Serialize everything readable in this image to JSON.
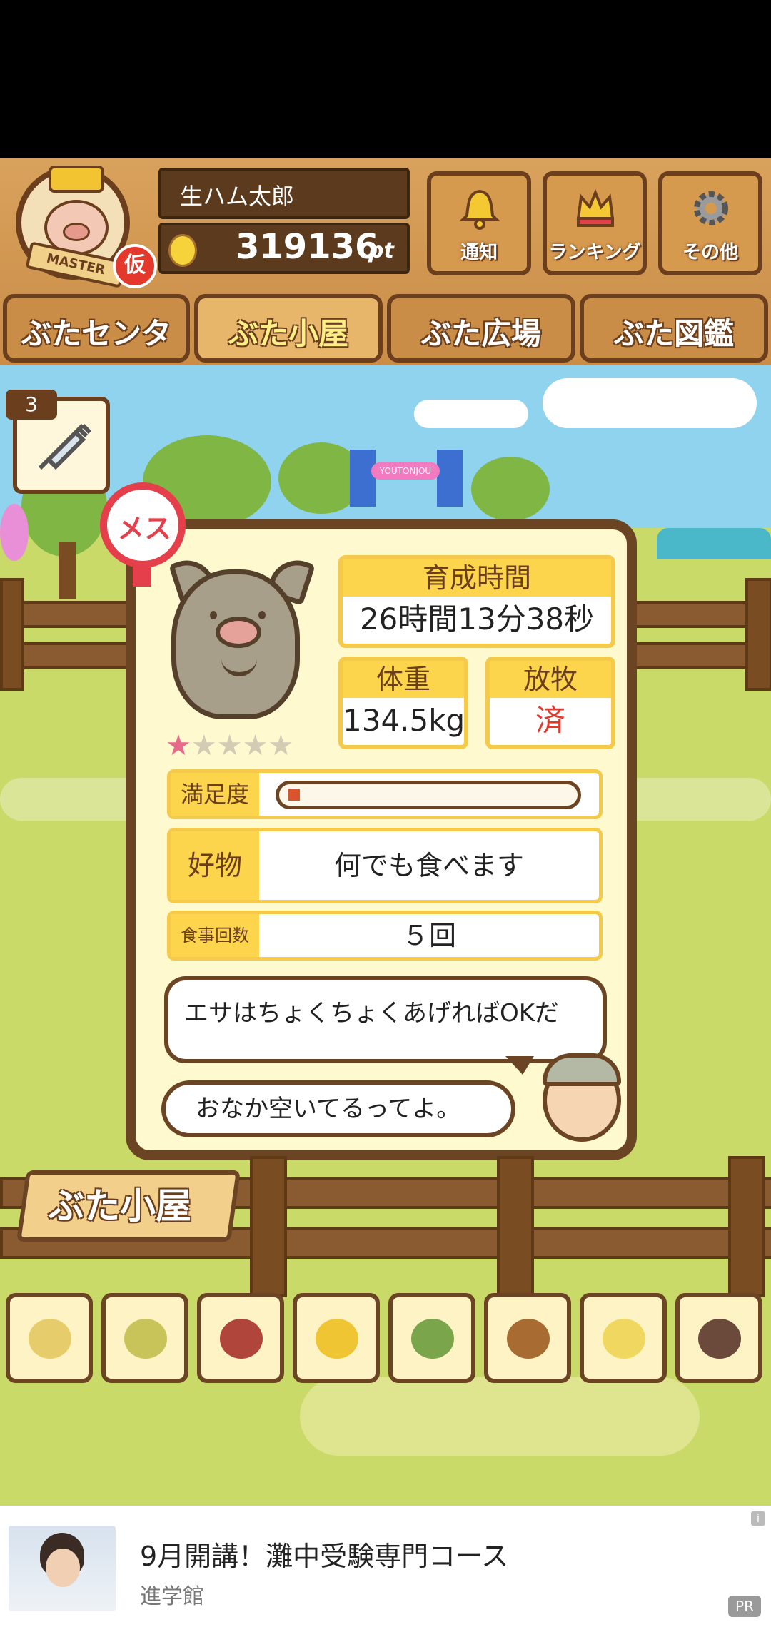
{
  "header": {
    "badge_label": "MASTER",
    "kari_label": "仮",
    "username": "生ハム太郎",
    "points": "319136",
    "points_unit": "pt",
    "buttons": [
      {
        "label": "通知",
        "icon": "bell-icon"
      },
      {
        "label": "ランキング",
        "icon": "crown-icon"
      },
      {
        "label": "その他",
        "icon": "gear-icon"
      }
    ]
  },
  "tabs": [
    {
      "label": "ぶたセンター",
      "active": false
    },
    {
      "label": "ぶた小屋",
      "active": true
    },
    {
      "label": "ぶた広場",
      "active": false
    },
    {
      "label": "ぶた図鑑",
      "active": false
    }
  ],
  "scene": {
    "gate_sign": "YOUTONJOU",
    "syringe_count": "3"
  },
  "pig": {
    "gender": "メス",
    "rating": 1,
    "rating_max": 5,
    "growth_time_label": "育成時間",
    "growth_time": "26時間13分38秒",
    "weight_label": "体重",
    "weight": "134.5kg",
    "grazing_label": "放牧",
    "grazing": "済",
    "satisfaction_label": "満足度",
    "satisfaction": 0.04,
    "favorite_label": "好物",
    "favorite": "何でも食べます",
    "meals_label": "食事回数",
    "meals": "５回"
  },
  "dialog": {
    "farmer_speech": "エサはちょくちょくあげればOKだ",
    "pig_speech": "おなか空いてるってよ。"
  },
  "sign_label": "ぶた小屋",
  "food_items": [
    "beans-icon",
    "mixed-beans-icon",
    "sweet-potato-icon",
    "corn-icon",
    "vegetable-icon",
    "acorn-icon",
    "grain-plate-icon",
    "meat-plate-icon"
  ],
  "ad": {
    "title": "9月開講！灘中受験専門コース",
    "sponsor": "進学館",
    "info": "i",
    "pr": "PR"
  },
  "colors": {
    "accent": "#fcd54c",
    "wood": "#6b4423",
    "red": "#e4382d"
  }
}
